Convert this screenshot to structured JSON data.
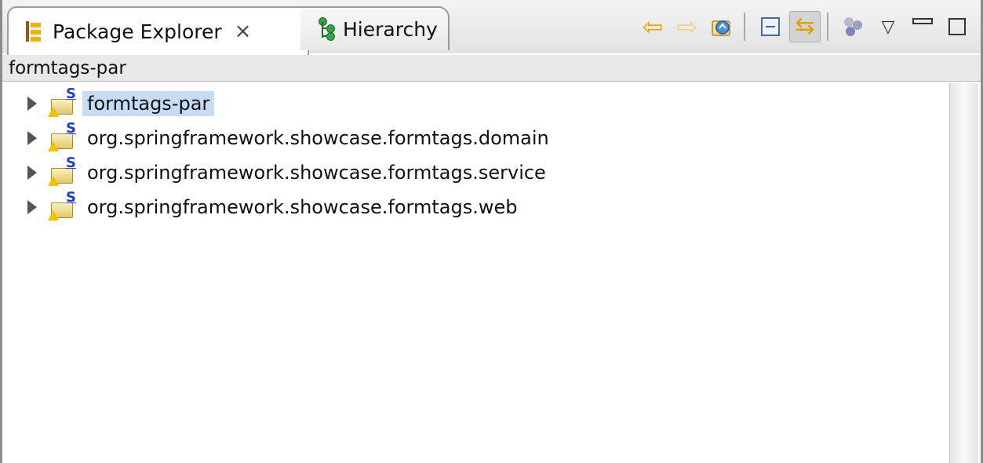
{
  "tabs": {
    "active": {
      "label": "Package Explorer",
      "icon": "package-explorer-icon"
    },
    "inactive": {
      "label": "Hierarchy",
      "icon": "hierarchy-icon"
    }
  },
  "toolbar": {
    "buttons": [
      "back-icon",
      "forward-icon",
      "up-icon",
      "collapse-all-icon",
      "link-with-editor-icon",
      "filter-icon",
      "view-menu-icon",
      "minimize-icon",
      "maximize-icon"
    ]
  },
  "breadcrumb": {
    "text": "formtags-par"
  },
  "tree": {
    "items": [
      {
        "label": "formtags-par",
        "selected": true
      },
      {
        "label": "org.springframework.showcase.formtags.domain",
        "selected": false
      },
      {
        "label": "org.springframework.showcase.formtags.service",
        "selected": false
      },
      {
        "label": "org.springframework.showcase.formtags.web",
        "selected": false
      }
    ]
  },
  "colors": {
    "selection": "#c7dcf4",
    "tabbar": "#e2e2e2",
    "accent": "#e8a700"
  }
}
